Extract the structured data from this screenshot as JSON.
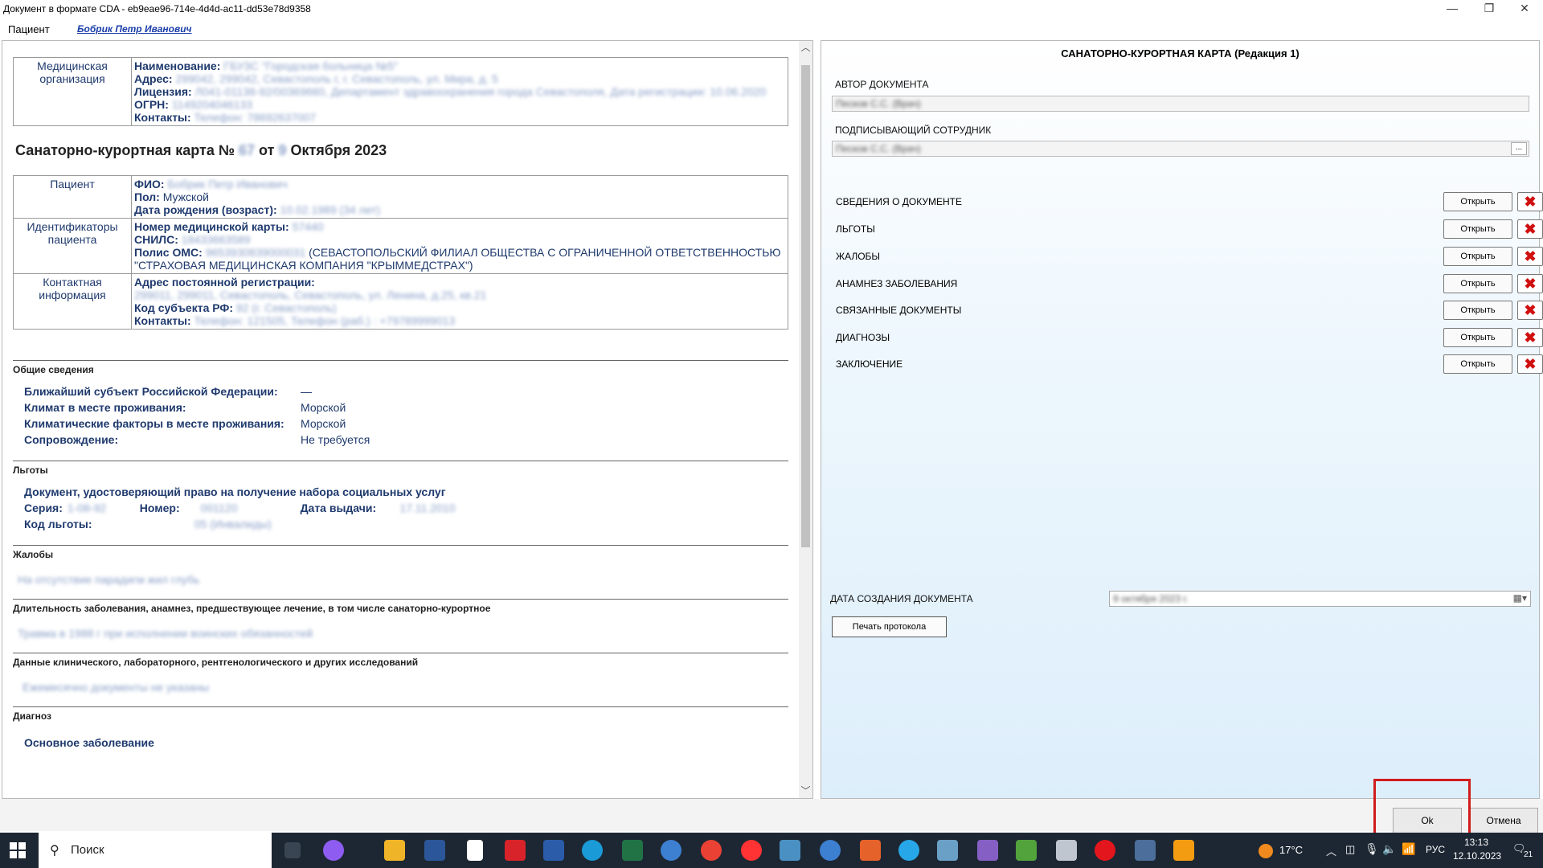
{
  "window": {
    "title": "Документ в формате CDA - eb9eae96-714e-4d4d-ac11-dd53e78d9358",
    "controls": [
      "—",
      "❐",
      "✕"
    ]
  },
  "menubar": {
    "patient_label": "Пациент",
    "patient_name": "Бобрик Петр Иванович"
  },
  "document": {
    "org": {
      "label": "Медицинская организация",
      "name_key": "Наименование:",
      "name_val": "ГБУЗС \"Городская больница №5\"",
      "addr_key": "Адрес:",
      "addr_val": "299042, 299042, Севастополь г, г. Севастополь, ул. Мира, д. 5",
      "lic_key": "Лицензия:",
      "lic_val": "Л041-01138-92/00369660, Департамент здравоохранения города Севастополя, Дата регистрации: 10.06.2020",
      "ogrn_key": "ОГРН:",
      "ogrn_val": "1149204046133",
      "contacts_key": "Контакты:",
      "contacts_val": "Телефон: 78692637007"
    },
    "heading": {
      "prefix": "Санаторно-курортная карта №",
      "number": "67",
      "from": "от",
      "day": "9",
      "month_year": "Октября 2023"
    },
    "patient": {
      "label": "Пациент",
      "fio_key": "ФИО:",
      "fio_val": "Бобрик Петр Иванович",
      "sex_key": "Пол:",
      "sex_val": "Мужской",
      "dob_key": "Дата рождения (возраст):",
      "dob_val": "10.02.1989 (34 лет)"
    },
    "ids": {
      "label": "Идентификаторы пациента",
      "card_key": "Номер медицинской карты:",
      "card_val": "57440",
      "snils_key": "СНИЛС:",
      "snils_val": "18433663589",
      "oms_key": "Полис ОМС:",
      "oms_num": "9653930839000031",
      "oms_org": "(СЕВАСТОПОЛЬСКИЙ ФИЛИАЛ ОБЩЕСТВА С ОГРАНИЧЕННОЙ ОТВЕТСТВЕННОСТЬЮ \"СТРАХОВАЯ МЕДИЦИНСКАЯ КОМПАНИЯ \"КРЫММЕДСТРАХ\")"
    },
    "contact": {
      "label": "Контактная информация",
      "addr_key": "Адрес постоянной регистрации:",
      "addr_val": "299011, 299011, Севастополь, Севастополь, ул. Ленина, д.25, кв.21",
      "subj_key": "Код субъекта РФ:",
      "subj_val": "92 (г. Севастополь)",
      "cont_key": "Контакты:",
      "cont_val": "Телефон: 121505, Телефон (раб.) : +79789999013"
    },
    "general": {
      "title": "Общие сведения",
      "rows": [
        {
          "k": "Ближайший субъект Российской Федерации:",
          "v": "—"
        },
        {
          "k": "Климат в месте проживания:",
          "v": "Морской"
        },
        {
          "k": "Климатические факторы в месте проживания:",
          "v": "Морской"
        },
        {
          "k": "Сопровождение:",
          "v": "Не требуется"
        }
      ]
    },
    "benefits": {
      "title": "Льготы",
      "doc_title": "Документ, удостоверяющий право на получение набора социальных услуг",
      "series_key": "Серия:",
      "series_val": "1-08-92",
      "number_key": "Номер:",
      "number_val": "001120",
      "date_key": "Дата выдачи:",
      "date_val": "17.11.2010",
      "code_key": "Код льготы:",
      "code_val": "05 (Инвалиды)"
    },
    "complaints": {
      "title": "Жалобы",
      "text": "На отсутствие парадигм жил глубь"
    },
    "history": {
      "title": "Длительность заболевания, анамнез, предшествующее лечение, в том числе санаторно-курортное",
      "text": "Травма в 1988 г при исполнении воинских обязанностей"
    },
    "clinical": {
      "title": "Данные клинического, лабораторного, рентгенологического и других исследований",
      "text": "Ежемесячно документы не указаны"
    },
    "diagnosis": {
      "title": "Диагноз",
      "main": "Основное заболевание"
    }
  },
  "form": {
    "title": "САНАТОРНО-КУРОРТНАЯ КАРТА  (Редакция 1)",
    "author_label": "АВТОР ДОКУМЕНТА",
    "author_val": "Песков С.С. (Врач)",
    "signer_label": "ПОДПИСЫВАЮЩИЙ СОТРУДНИК",
    "signer_val": "Песков С.С. (Врач)",
    "sections": [
      {
        "label": "СВЕДЕНИЯ О ДОКУМЕНТЕ",
        "open": "Открыть"
      },
      {
        "label": "ЛЬГОТЫ",
        "open": "Открыть"
      },
      {
        "label": "ЖАЛОБЫ",
        "open": "Открыть"
      },
      {
        "label": "АНАМНЕЗ ЗАБОЛЕВАНИЯ",
        "open": "Открыть"
      },
      {
        "label": "СВЯЗАННЫЕ ДОКУМЕНТЫ",
        "open": "Открыть"
      },
      {
        "label": "ДИАГНОЗЫ",
        "open": "Открыть"
      },
      {
        "label": "ЗАКЛЮЧЕНИЕ",
        "open": "Открыть"
      }
    ],
    "date_label": "ДАТА СОЗДАНИЯ ДОКУМЕНТА",
    "date_val": "9 октября 2023 г.",
    "print_btn": "Печать протокола"
  },
  "buttons": {
    "ok": "Ok",
    "cancel": "Отмена"
  },
  "taskbar": {
    "search_placeholder": "Поиск",
    "temp": "17°C",
    "lang": "РУС",
    "time": "13:13",
    "date": "12.10.2023",
    "notif_count": "21"
  },
  "colors": {
    "accent_blue": "#1f3a6e",
    "delete_red": "#d01010",
    "highlight_red": "#d01c1c",
    "taskbar": "#1d2733"
  }
}
